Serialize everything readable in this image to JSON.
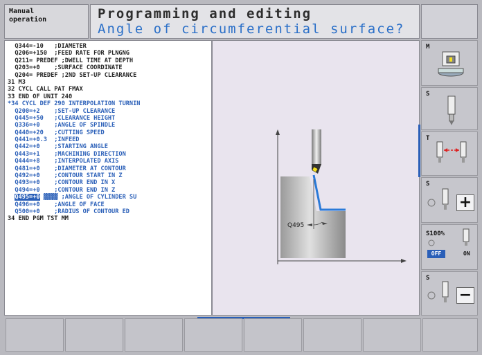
{
  "header": {
    "mode": "Manual\noperation",
    "title": "Programming and editing",
    "prompt": "Angle of circumferential surface?"
  },
  "program": {
    "lines": [
      {
        "text": "  Q344=-10   ;DIAMETER",
        "style": "normal"
      },
      {
        "text": "  Q206=+150  ;FEED RATE FOR PLNGNG",
        "style": "normal"
      },
      {
        "text": "  Q211= PREDEF ;DWELL TIME AT DEPTH",
        "style": "normal"
      },
      {
        "text": "  Q203=+0    ;SURFACE COORDINATE",
        "style": "normal"
      },
      {
        "text": "  Q204= PREDEF ;2ND SET-UP CLEARANCE",
        "style": "normal"
      },
      {
        "text": "31 M3",
        "style": "normal"
      },
      {
        "text": "32 CYCL CALL PAT FMAX",
        "style": "normal"
      },
      {
        "text": "33 END OF UNIT 240",
        "style": "normal"
      },
      {
        "text": "*34 CYCL DEF 290 INTERPOLATION TURNIN",
        "style": "blue"
      },
      {
        "text": "  Q200=+2    ;SET-UP CLEARANCE",
        "style": "blue"
      },
      {
        "text": "  Q445=+50   ;CLEARANCE HEIGHT",
        "style": "blue"
      },
      {
        "text": "  Q336=+0    ;ANGLE OF SPINDLE",
        "style": "blue"
      },
      {
        "text": "  Q440=+20   ;CUTTING SPEED",
        "style": "blue"
      },
      {
        "text": "  Q441=+0.3  ;INFEED",
        "style": "blue"
      },
      {
        "text": "  Q442=+0    ;STARTING ANGLE",
        "style": "blue"
      },
      {
        "text": "  Q443=+1    ;MACHINING DIRECTION",
        "style": "blue"
      },
      {
        "text": "  Q444=+8    ;INTERPOLATED AXIS",
        "style": "blue"
      },
      {
        "text": "  Q481=+0    ;DIAMETER AT CONTOUR",
        "style": "blue"
      },
      {
        "text": "  Q492=+0    ;CONTOUR START IN Z",
        "style": "blue"
      },
      {
        "text": "  Q493=+0    ;CONTOUR END IN X",
        "style": "blue"
      },
      {
        "text": "  Q494=+0    ;CONTOUR END IN Z",
        "style": "blue"
      },
      {
        "text": "  Q495=+0 ▓▓▓▓ ;ANGLE OF CYLINDER SU",
        "style": "hl"
      },
      {
        "text": "  Q496=+0    ;ANGLE OF FACE",
        "style": "blue"
      },
      {
        "text": "  Q500=+0    ;RADIUS OF CONTOUR ED",
        "style": "blue"
      },
      {
        "text": "34 END PGM TST MM",
        "style": "normal"
      }
    ]
  },
  "graphic": {
    "dimension_label": "Q495"
  },
  "softkeys_right": [
    {
      "label": "M"
    },
    {
      "label": "S"
    },
    {
      "label": "T"
    },
    {
      "label": "S",
      "action": "+"
    },
    {
      "label": "S100%",
      "off": "OFF",
      "on": "ON"
    },
    {
      "label": "S",
      "action": "−"
    }
  ],
  "colors": {
    "accent": "#2a5fb8",
    "highlight": "#f5e020"
  }
}
